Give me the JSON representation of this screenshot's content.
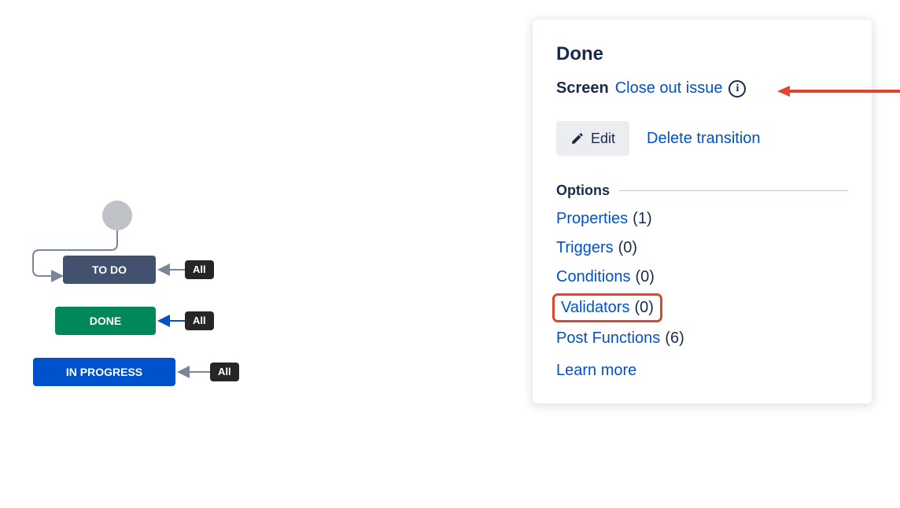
{
  "workflow": {
    "nodes": {
      "todo": {
        "label": "TO DO"
      },
      "done": {
        "label": "DONE"
      },
      "inprog": {
        "label": "IN PROGRESS"
      }
    },
    "all_pill": "All"
  },
  "panel": {
    "title": "Done",
    "screen_label": "Screen",
    "screen_link": "Close out issue",
    "edit_label": "Edit",
    "delete_label": "Delete transition",
    "options_heading": "Options",
    "options": {
      "properties": {
        "name": "Properties",
        "count": "(1)"
      },
      "triggers": {
        "name": "Triggers",
        "count": "(0)"
      },
      "conditions": {
        "name": "Conditions",
        "count": "(0)"
      },
      "validators": {
        "name": "Validators",
        "count": "(0)"
      },
      "post_functions": {
        "name": "Post Functions",
        "count": "(6)"
      }
    },
    "learn_more": "Learn more"
  }
}
